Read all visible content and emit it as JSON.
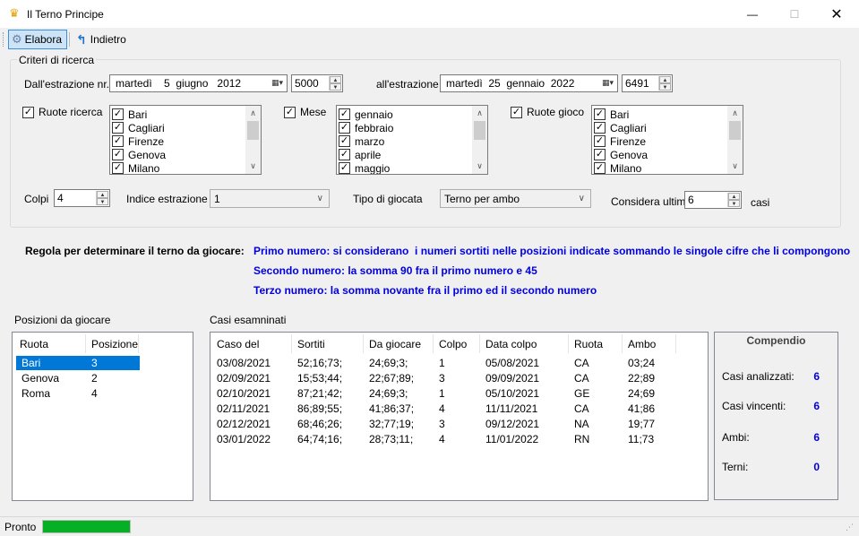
{
  "window": {
    "title": "Il Terno Principe",
    "min_symbol": "—",
    "max_symbol": "☐",
    "close_symbol": "✕"
  },
  "toolbar": {
    "elabora_label": "Elabora",
    "indietro_label": "Indietro"
  },
  "criteria": {
    "group_label": "Criteri di ricerca",
    "from_label": "Dall'estrazione nr.",
    "from_date": "martedì    5  giugno   2012",
    "from_number": "5000",
    "to_label": "all'estrazione",
    "to_date": "martedì  25  gennaio  2022",
    "to_number": "6491",
    "ruote_ricerca_label": "Ruote ricerca",
    "ruote_ricerca_items": [
      "Bari",
      "Cagliari",
      "Firenze",
      "Genova",
      "Milano"
    ],
    "mese_label": "Mese",
    "mese_items": [
      "gennaio",
      "febbraio",
      "marzo",
      "aprile",
      "maggio"
    ],
    "ruote_gioco_label": "Ruote gioco",
    "ruote_gioco_items": [
      "Bari",
      "Cagliari",
      "Firenze",
      "Genova",
      "Milano"
    ],
    "colpi_label": "Colpi",
    "colpi_value": "4",
    "indice_label": "Indice estrazione",
    "indice_value": "1",
    "tipo_label": "Tipo di giocata",
    "tipo_value": "Terno per ambo",
    "considera_label": "Considera ultimi",
    "considera_value": "6",
    "casi_label": "casi"
  },
  "rule": {
    "heading": "Regola per determinare il terno da giocare:",
    "line1": "Primo numero: si considerano  i numeri sortiti nelle posizioni indicate sommando le singole cifre che li compongono",
    "line2": "Secondo numero: la somma 90 fra il primo numero e 45",
    "line3": "Terzo numero: la somma novante fra il primo ed il secondo numero"
  },
  "positions": {
    "label": "Posizioni da giocare",
    "columns": [
      "Ruota",
      "Posizione"
    ],
    "rows": [
      {
        "ruota": "Bari",
        "posizione": "3"
      },
      {
        "ruota": "Genova",
        "posizione": "2"
      },
      {
        "ruota": "Roma",
        "posizione": "4"
      }
    ]
  },
  "cases": {
    "label": "Casi esamninati",
    "columns": [
      "Caso del",
      "Sortiti",
      "Da giocare",
      "Colpo",
      "Data colpo",
      "Ruota",
      "Ambo"
    ],
    "rows": [
      {
        "caso": "03/08/2021",
        "sortiti": "52;16;73;",
        "da_giocare": "24;69;3;",
        "colpo": "1",
        "data_colpo": "05/08/2021",
        "ruota": "CA",
        "ambo": "03;24"
      },
      {
        "caso": "02/09/2021",
        "sortiti": "15;53;44;",
        "da_giocare": "22;67;89;",
        "colpo": "3",
        "data_colpo": "09/09/2021",
        "ruota": "CA",
        "ambo": "22;89"
      },
      {
        "caso": "02/10/2021",
        "sortiti": "87;21;42;",
        "da_giocare": "24;69;3;",
        "colpo": "1",
        "data_colpo": "05/10/2021",
        "ruota": "GE",
        "ambo": "24;69"
      },
      {
        "caso": "02/11/2021",
        "sortiti": "86;89;55;",
        "da_giocare": "41;86;37;",
        "colpo": "4",
        "data_colpo": "11/11/2021",
        "ruota": "CA",
        "ambo": "41;86"
      },
      {
        "caso": "02/12/2021",
        "sortiti": "68;46;26;",
        "da_giocare": "32;77;19;",
        "colpo": "3",
        "data_colpo": "09/12/2021",
        "ruota": "NA",
        "ambo": "19;77"
      },
      {
        "caso": "03/01/2022",
        "sortiti": "64;74;16;",
        "da_giocare": "28;73;11;",
        "colpo": "4",
        "data_colpo": "11/01/2022",
        "ruota": "RN",
        "ambo": "11;73"
      }
    ]
  },
  "compendio": {
    "title": "Compendio",
    "analizzati_label": "Casi analizzati:",
    "analizzati_value": "6",
    "vincenti_label": "Casi vincenti:",
    "vincenti_value": "6",
    "ambi_label": "Ambi:",
    "ambi_value": "6",
    "terni_label": "Terni:",
    "terni_value": "0"
  },
  "status": {
    "text": "Pronto",
    "progress_fraction": 1.0,
    "progress_color": "#06b025"
  },
  "colors": {
    "rule_text": "#0000e0",
    "selection": "#0078d7"
  }
}
